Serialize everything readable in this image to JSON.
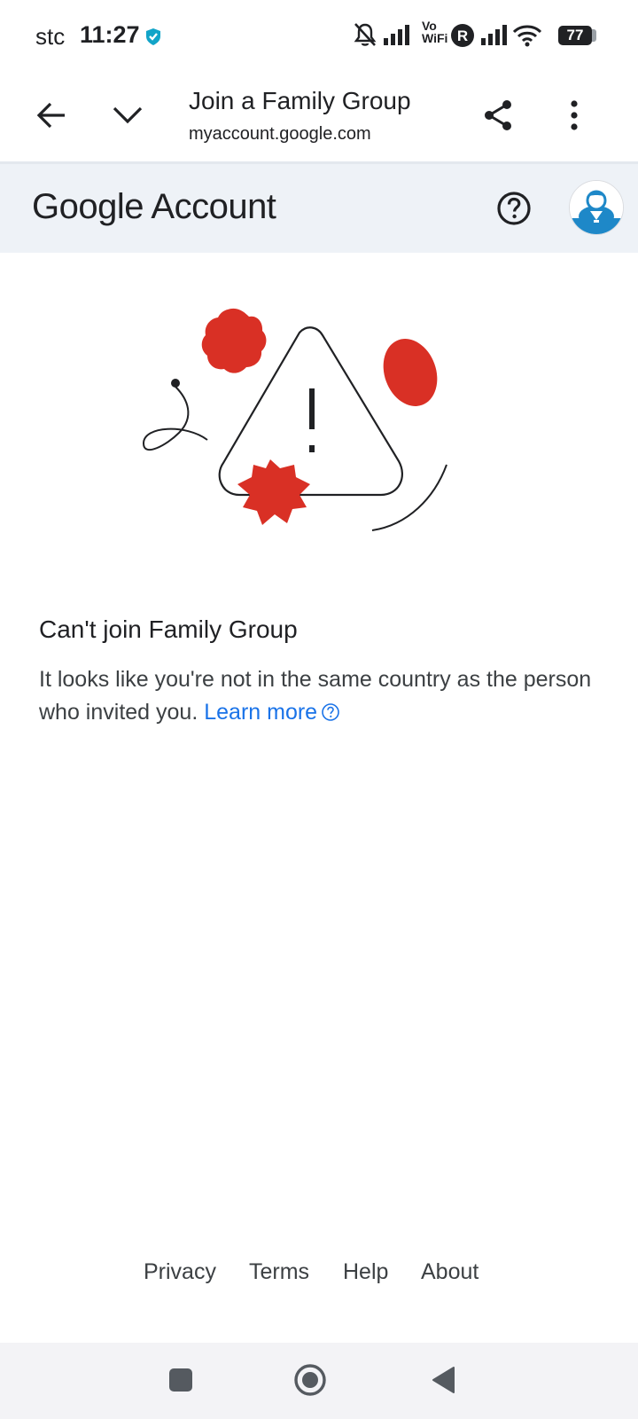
{
  "status_bar": {
    "carrier": "stc",
    "time": "11:27",
    "vowifi_line1": "Vo",
    "vowifi_line2": "WiFi",
    "roaming_letter": "R",
    "battery": "77"
  },
  "browser": {
    "page_title": "Join a Family Group",
    "url": "myaccount.google.com"
  },
  "header": {
    "brand_google": "Google",
    "brand_account": "Account"
  },
  "message": {
    "title": "Can't join Family Group",
    "body": "It looks like you're not in the same country as the person who invited you.",
    "learn_more": "Learn more"
  },
  "footer": {
    "links": [
      "Privacy",
      "Terms",
      "Help",
      "About"
    ]
  },
  "colors": {
    "accent_blue": "#1a73e8",
    "illustration_red": "#d93025",
    "header_bg": "#eef2f7"
  }
}
